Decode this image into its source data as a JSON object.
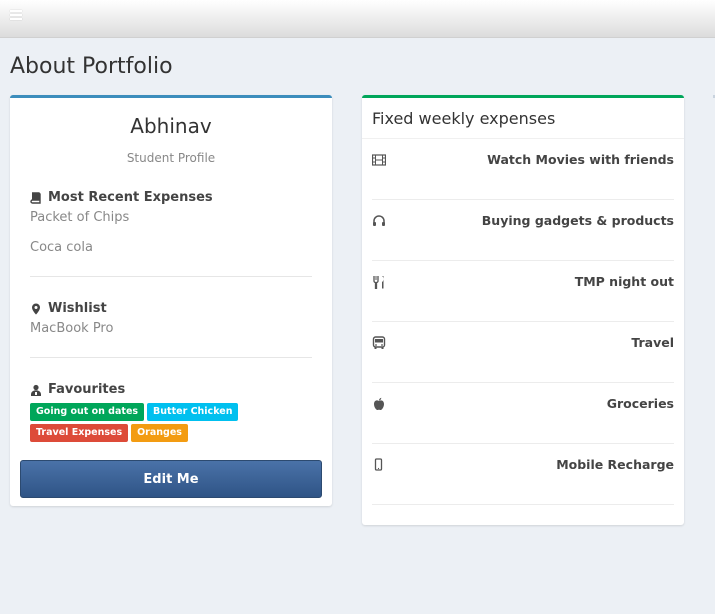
{
  "page": {
    "title": "About Portfolio"
  },
  "profile": {
    "name": "Abhinav",
    "subtitle": "Student Profile",
    "recent_expenses": {
      "heading": "Most Recent Expenses",
      "icon": "book-icon",
      "items": [
        "Packet of Chips",
        "Coca cola"
      ]
    },
    "wishlist": {
      "heading": "Wishlist",
      "icon": "map-marker-icon",
      "items": [
        "MacBook Pro"
      ]
    },
    "favourites": {
      "heading": "Favourites",
      "icon": "user-icon",
      "tags": [
        {
          "label": "Going out on dates",
          "color": "#00a65a"
        },
        {
          "label": "Butter Chicken",
          "color": "#00c0ef"
        },
        {
          "label": "Travel Expenses",
          "color": "#dd4b39"
        },
        {
          "label": "Oranges",
          "color": "#f39c12"
        }
      ]
    },
    "edit_label": "Edit Me"
  },
  "expenses": {
    "title": "Fixed weekly expenses",
    "items": [
      {
        "label": "Watch Movies with friends",
        "icon": "film-icon"
      },
      {
        "label": "Buying gadgets & products",
        "icon": "headphones-icon"
      },
      {
        "label": "TMP night out",
        "icon": "cutlery-icon"
      },
      {
        "label": "Travel",
        "icon": "bus-icon"
      },
      {
        "label": "Groceries",
        "icon": "apple-icon"
      },
      {
        "label": "Mobile Recharge",
        "icon": "mobile-icon"
      }
    ]
  },
  "colors": {
    "profile_accent": "#3c8dbc",
    "expenses_accent": "#00a65a",
    "background": "#ecf0f5"
  }
}
